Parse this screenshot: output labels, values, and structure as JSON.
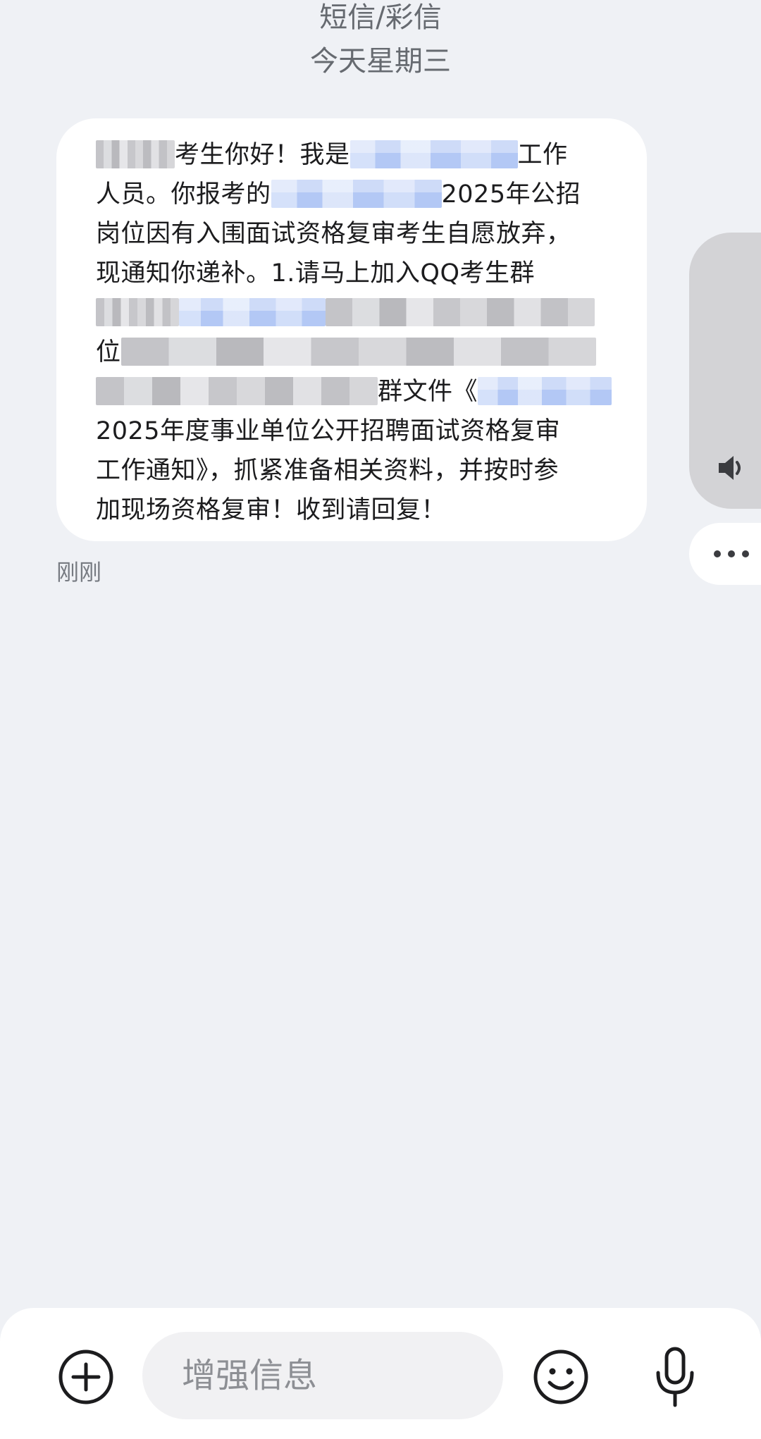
{
  "header": {
    "title": "短信/彩信",
    "date": "今天星期三"
  },
  "message": {
    "lines": [
      [
        "",
        "考生你好！我是",
        "",
        "工作"
      ],
      [
        "人员。你报考的",
        "",
        "2025年公招"
      ],
      [
        "岗位因有入围面试资格复审考生自愿放弃，"
      ],
      [
        "现通知你递补。1.请马上加入QQ考生群"
      ],
      [
        ""
      ],
      [
        "位",
        ""
      ],
      [
        "",
        "群文件《",
        ""
      ],
      [
        "2025年度事业单位公开招聘面试资格复审"
      ],
      [
        "工作通知》，抓紧准备相关资料，并按时参"
      ],
      [
        "加现场资格复审！收到请回复！"
      ]
    ],
    "timestamp": "刚刚"
  },
  "composer": {
    "placeholder": "增强信息"
  },
  "icons": {
    "speaker": "speaker-icon",
    "more": "more-dots-icon",
    "add": "add-circle-icon",
    "emoji": "emoji-icon",
    "mic": "microphone-icon"
  }
}
